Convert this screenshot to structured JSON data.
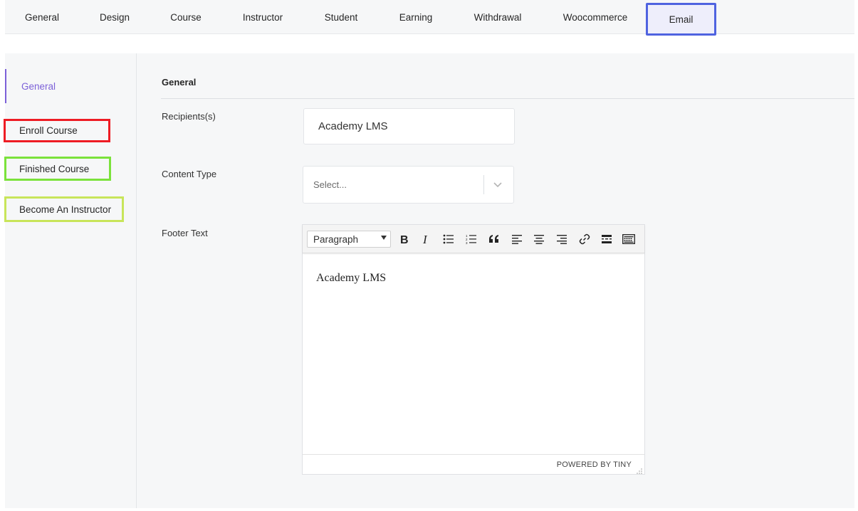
{
  "tabs": [
    {
      "label": "General"
    },
    {
      "label": "Design"
    },
    {
      "label": "Course"
    },
    {
      "label": "Instructor"
    },
    {
      "label": "Student"
    },
    {
      "label": "Earning"
    },
    {
      "label": "Withdrawal"
    },
    {
      "label": "Woocommerce"
    },
    {
      "label": "Email",
      "active": true
    }
  ],
  "sidebar": {
    "items": [
      {
        "label": "General",
        "active": true
      },
      {
        "label": "Enroll Course"
      },
      {
        "label": "Finished Course"
      },
      {
        "label": "Become An Instructor"
      }
    ]
  },
  "main": {
    "section_title": "General",
    "recipients": {
      "label": "Recipients(s)",
      "value": "Academy LMS"
    },
    "content_type": {
      "label": "Content Type",
      "placeholder": "Select..."
    },
    "footer_text": {
      "label": "Footer Text",
      "block_format": "Paragraph",
      "content": "Academy LMS",
      "powered_by": "POWERED BY TINY"
    }
  },
  "colors": {
    "accent_purple": "#7c61d8",
    "active_tab_border": "#4f63e0",
    "highlight_red": "#ee1c24",
    "highlight_green": "#7be23b",
    "highlight_yellow_green": "#c8e55a"
  },
  "icons": {
    "toolbar": [
      "bold-icon",
      "italic-icon",
      "bullet-list-icon",
      "numbered-list-icon",
      "blockquote-icon",
      "align-left-icon",
      "align-center-icon",
      "align-right-icon",
      "link-icon",
      "horizontal-rule-icon",
      "keyboard-icon"
    ],
    "select_caret": "chevron-down-icon"
  }
}
